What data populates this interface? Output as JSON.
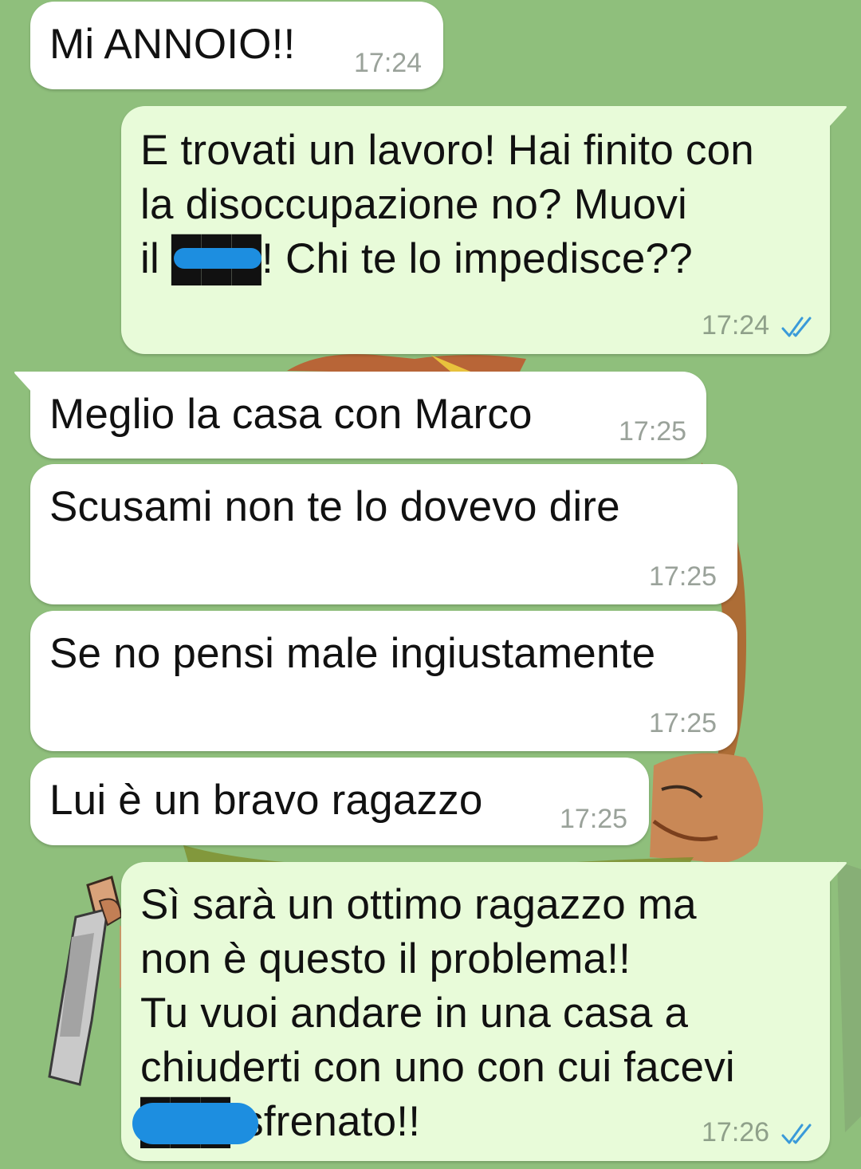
{
  "theme": {
    "wallpaper_color": "#8fbf7c",
    "incoming_bubble_color": "#ffffff",
    "outgoing_bubble_color": "#e8fbd9",
    "tick_color": "#3a9ad9",
    "redaction_color": "#1d8ee0"
  },
  "messages": [
    {
      "direction": "incoming",
      "lines": [
        "Mi ANNOIO!!"
      ],
      "time": "17:24"
    },
    {
      "direction": "outgoing",
      "lines": [
        "E trovati un lavoro! Hai finito con",
        "la disoccupazione no? Muovi",
        "il ███! Chi te lo impedisce??"
      ],
      "time": "17:24",
      "status": "read-double-check-icon"
    },
    {
      "direction": "incoming",
      "lines": [
        "Meglio la casa con Marco"
      ],
      "time": "17:25"
    },
    {
      "direction": "incoming",
      "lines": [
        "Scusami non te lo dovevo dire"
      ],
      "time": "17:25"
    },
    {
      "direction": "incoming",
      "lines": [
        "Se no pensi male ingiustamente"
      ],
      "time": "17:25"
    },
    {
      "direction": "incoming",
      "lines": [
        "Lui è un bravo ragazzo"
      ],
      "time": "17:25"
    },
    {
      "direction": "outgoing",
      "lines": [
        "Sì sarà un ottimo ragazzo ma",
        "non è questo il problema!!",
        "Tu vuoi andare in una casa a",
        "chiuderti con uno con cui facevi",
        "███ sfrenato!!"
      ],
      "time": "17:26",
      "status": "read-double-check-icon"
    }
  ]
}
